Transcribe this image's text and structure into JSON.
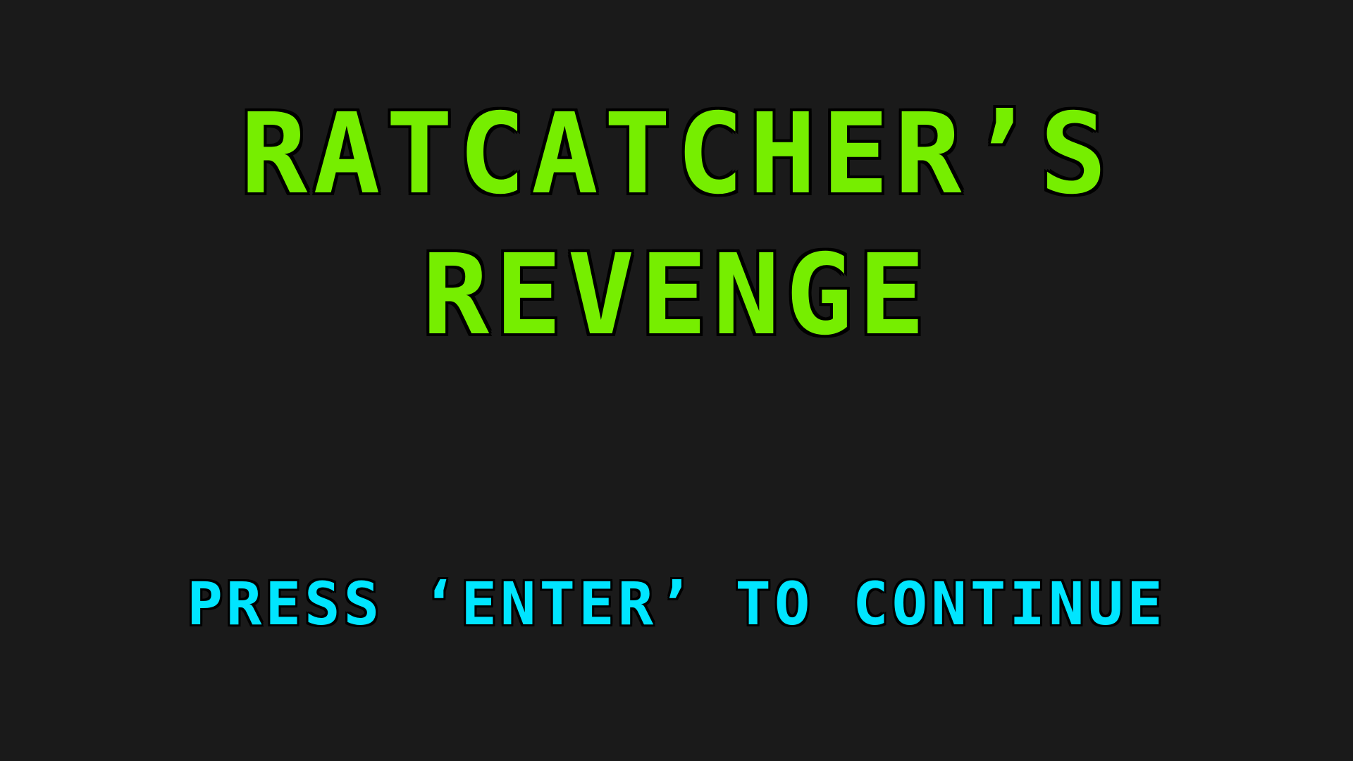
{
  "title": {
    "line1": "RATCATCHER’S",
    "line2": "REVENGE"
  },
  "prompt": "PRESS ‘ENTER’ TO CONTINUE",
  "colors": {
    "background": "#1a1a1a",
    "title": "#76ee00",
    "prompt": "#00e5ff",
    "outline": "#000000"
  }
}
